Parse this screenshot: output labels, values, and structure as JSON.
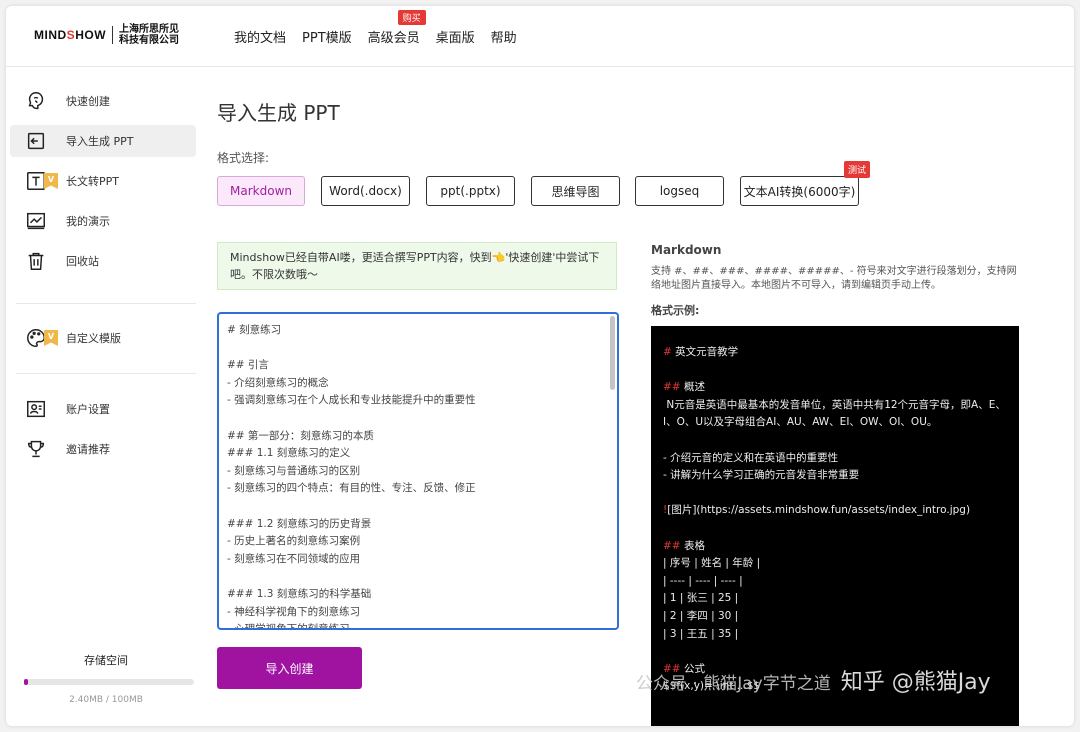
{
  "logo": {
    "brand": "MINDSHOW",
    "brand_pre": "MIND",
    "brand_dot": "S",
    "brand_post": "HOW",
    "company_line1": "上海所思所见",
    "company_line2": "科技有限公司"
  },
  "nav": [
    {
      "label": "我的文档"
    },
    {
      "label": "PPT模版"
    },
    {
      "label": "高级会员",
      "badge": "购买"
    },
    {
      "label": "桌面版"
    },
    {
      "label": "帮助"
    }
  ],
  "sidebar": {
    "items": [
      {
        "label": "快速创建",
        "icon": "brain-icon"
      },
      {
        "label": "导入生成 PPT",
        "icon": "import-icon"
      },
      {
        "label": "长文转PPT",
        "icon": "text-icon",
        "vip": "V"
      },
      {
        "label": "我的演示",
        "icon": "presentation-icon"
      },
      {
        "label": "回收站",
        "icon": "trash-icon"
      },
      {
        "label": "自定义模版",
        "icon": "palette-icon",
        "vip": "V"
      },
      {
        "label": "账户设置",
        "icon": "account-icon"
      },
      {
        "label": "邀请推荐",
        "icon": "trophy-icon"
      }
    ],
    "storage": {
      "title": "存储空间",
      "used_text": "2.40MB / 100MB",
      "fraction": 0.024
    }
  },
  "main": {
    "title": "导入生成 PPT",
    "format_label": "格式选择:",
    "formats": [
      {
        "label": "Markdown"
      },
      {
        "label": "Word(.docx)"
      },
      {
        "label": "ppt(.pptx)"
      },
      {
        "label": "思维导图"
      },
      {
        "label": "logseq"
      },
      {
        "label": "文本AI转换(6000字)",
        "badge": "测试"
      }
    ],
    "notice": "Mindshow已经自带AI喽，更适合撰写PPT内容，快到👈'快速创建'中尝试下吧。不限次数哦～",
    "editor_text": "# 刻意练习\n\n## 引言\n- 介绍刻意练习的概念\n- 强调刻意练习在个人成长和专业技能提升中的重要性\n\n## 第一部分：刻意练习的本质\n### 1.1 刻意练习的定义\n- 刻意练习与普通练习的区别\n- 刻意练习的四个特点：有目的性、专注、反馈、修正\n\n### 1.2 刻意练习的历史背景\n- 历史上著名的刻意练习案例\n- 刻意练习在不同领域的应用\n\n### 1.3 刻意练习的科学基础\n- 神经科学视角下的刻意练习\n- 心理学视角下的刻意练习",
    "import_button": "导入创建"
  },
  "markdown_help": {
    "title": "Markdown",
    "description": "支持 #、##、###、####、#####、- 符号来对文字进行段落划分，支持网络地址图片直接导入。本地图片不可导入，请到编辑页手动上传。",
    "example_label": "格式示例:",
    "example": {
      "h1": "英文元音教学",
      "h2_overview": "概述",
      "overview_text": " N元音是英语中最基本的发音单位，英语中共有12个元音字母，即A、E、I、O、U以及字母组合AI、AU、AW、EI、OW、OI、OU。",
      "bullet1": "- 介绍元音的定义和在英语中的重要性",
      "bullet2": "- 讲解为什么学习正确的元音发音非常重要",
      "image_bang": "!",
      "image_line": "[图片](https://assets.mindshow.fun/assets/index_intro.jpg)",
      "h2_table": "表格",
      "table_lines": "| 序号 | 姓名 | 年龄 |\n| ---- | ---- | ---- |\n| 1 | 张三 | 25 |\n| 2 | 李四 | 30 |\n| 3 | 王五 | 35 |",
      "h2_formula": "公式",
      "formula_line": "$$f(x,y)= \\int ...$$"
    }
  },
  "watermark": {
    "small": "公众号 · 熊猫Jay字节之道",
    "main": "知乎 @熊猫Jay"
  }
}
